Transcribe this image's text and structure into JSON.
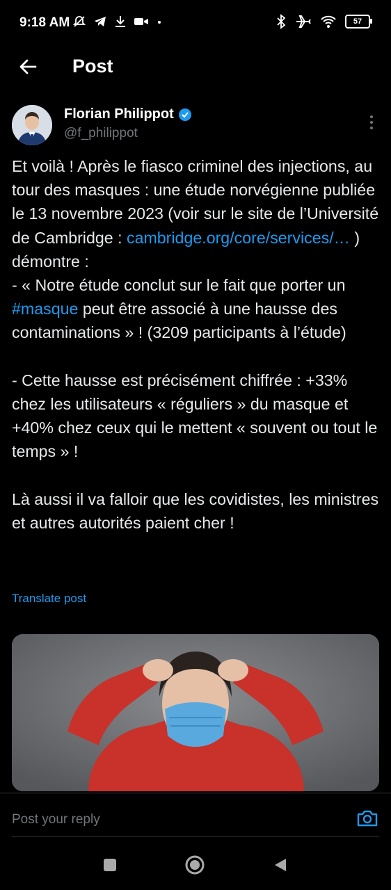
{
  "status_bar": {
    "time": "9:18 AM",
    "left_icons": [
      "mute-bell-icon",
      "telegram-icon",
      "download-icon",
      "video-icon",
      "dot-icon"
    ],
    "right_icons": [
      "bluetooth-icon",
      "airplane-icon",
      "wifi-icon",
      "battery-icon"
    ],
    "battery_level": "57"
  },
  "topbar": {
    "title": "Post",
    "back_icon": "back-arrow-icon"
  },
  "author": {
    "name": "Florian Philippot",
    "handle": "@f_philippot",
    "verified": true,
    "verified_color": "#1d9bf0"
  },
  "post": {
    "p1": "Et voilà ! Après le fiasco criminel des injections, au tour des masques : une étude norvégienne publiée le 13 novembre 2023 (voir sur le site de l’Université de Cambridge : ",
    "link": "cambridge.org/core/services/…",
    "p2": " ) démontre :\n- « Notre étude conclut sur le fait que porter un ",
    "hashtag": "#masque",
    "p3": " peut être associé à une hausse des contaminations » ! (3209 participants à l’étude)\n\n- Cette hausse est précisément chiffrée : +33% chez les utilisateurs « réguliers » du masque et +40% chez ceux qui le mettent « souvent ou tout le temps » !\n\nLà aussi il va falloir que les covidistes, les ministres et autres autorités paient cher !",
    "translate_label": "Translate post",
    "link_color": "#1d9bf0"
  },
  "reply": {
    "placeholder": "Post your reply"
  },
  "nav": {
    "items": [
      "recents-square-icon",
      "home-circle-icon",
      "back-triangle-icon"
    ]
  }
}
